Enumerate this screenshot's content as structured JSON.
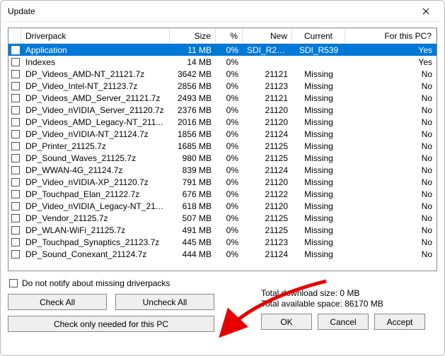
{
  "window": {
    "title": "Update"
  },
  "columns": {
    "name": "Driverpack",
    "size": "Size",
    "pct": "%",
    "new": "New",
    "current": "Current",
    "this": "For this PC?"
  },
  "rows": [
    {
      "name": "Application",
      "size": "11 MB",
      "pct": "0%",
      "new": "SDI_R21...",
      "current": "SDI_R539",
      "this": "Yes",
      "selected": true
    },
    {
      "name": "Indexes",
      "size": "14 MB",
      "pct": "0%",
      "new": "",
      "current": "",
      "this": "Yes"
    },
    {
      "name": "DP_Videos_AMD-NT_21121.7z",
      "size": "3642 MB",
      "pct": "0%",
      "new": "21121",
      "current": "Missing",
      "this": "No"
    },
    {
      "name": "DP_Video_Intel-NT_21123.7z",
      "size": "2856 MB",
      "pct": "0%",
      "new": "21123",
      "current": "Missing",
      "this": "No"
    },
    {
      "name": "DP_Videos_AMD_Server_21121.7z",
      "size": "2493 MB",
      "pct": "0%",
      "new": "21121",
      "current": "Missing",
      "this": "No"
    },
    {
      "name": "DP_Video_nVIDIA_Server_21120.7z",
      "size": "2376 MB",
      "pct": "0%",
      "new": "21120",
      "current": "Missing",
      "this": "No"
    },
    {
      "name": "DP_Videos_AMD_Legacy-NT_211...",
      "size": "2016 MB",
      "pct": "0%",
      "new": "21120",
      "current": "Missing",
      "this": "No"
    },
    {
      "name": "DP_Video_nVIDIA-NT_21124.7z",
      "size": "1856 MB",
      "pct": "0%",
      "new": "21124",
      "current": "Missing",
      "this": "No"
    },
    {
      "name": "DP_Printer_21125.7z",
      "size": "1685 MB",
      "pct": "0%",
      "new": "21125",
      "current": "Missing",
      "this": "No"
    },
    {
      "name": "DP_Sound_Waves_21125.7z",
      "size": "980 MB",
      "pct": "0%",
      "new": "21125",
      "current": "Missing",
      "this": "No"
    },
    {
      "name": "DP_WWAN-4G_21124.7z",
      "size": "839 MB",
      "pct": "0%",
      "new": "21124",
      "current": "Missing",
      "this": "No"
    },
    {
      "name": "DP_Video_nVIDIA-XP_21120.7z",
      "size": "791 MB",
      "pct": "0%",
      "new": "21120",
      "current": "Missing",
      "this": "No"
    },
    {
      "name": "DP_Touchpad_Elan_21122.7z",
      "size": "676 MB",
      "pct": "0%",
      "new": "21122",
      "current": "Missing",
      "this": "No"
    },
    {
      "name": "DP_Video_nVIDIA_Legacy-NT_211...",
      "size": "618 MB",
      "pct": "0%",
      "new": "21120",
      "current": "Missing",
      "this": "No"
    },
    {
      "name": "DP_Vendor_21125.7z",
      "size": "507 MB",
      "pct": "0%",
      "new": "21125",
      "current": "Missing",
      "this": "No"
    },
    {
      "name": "DP_WLAN-WiFi_21125.7z",
      "size": "491 MB",
      "pct": "0%",
      "new": "21125",
      "current": "Missing",
      "this": "No"
    },
    {
      "name": "DP_Touchpad_Synaptics_21123.7z",
      "size": "445 MB",
      "pct": "0%",
      "new": "21123",
      "current": "Missing",
      "this": "No"
    },
    {
      "name": "DP_Sound_Conexant_21124.7z",
      "size": "444 MB",
      "pct": "0%",
      "new": "21124",
      "current": "Missing",
      "this": "No"
    }
  ],
  "notify_label": "Do not notify about missing driverpacks",
  "stats": {
    "download": "Total download size: 0 MB",
    "space": "Total available space: 86170 MB"
  },
  "buttons": {
    "check_all": "Check All",
    "uncheck_all": "Uncheck All",
    "check_needed": "Check only needed for this PC",
    "ok": "OK",
    "cancel": "Cancel",
    "accept": "Accept"
  }
}
